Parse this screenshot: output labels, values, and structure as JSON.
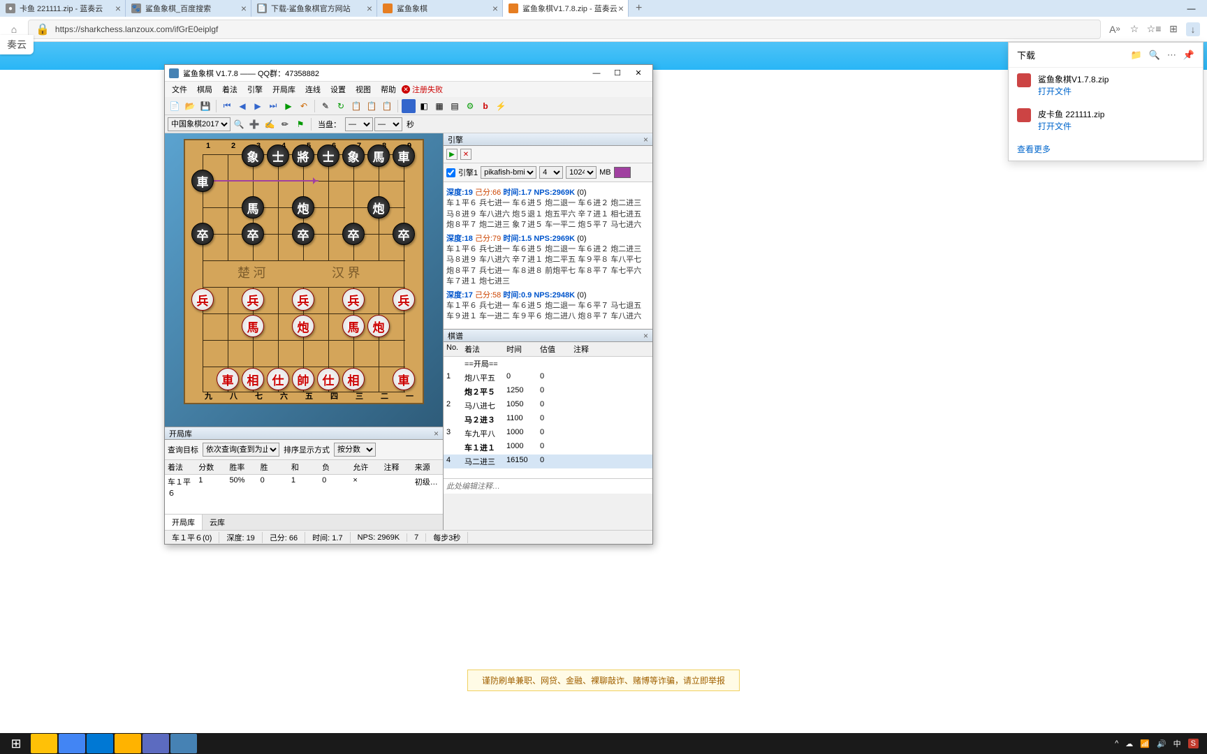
{
  "tabs": [
    {
      "title": "卡鱼 221111.zip - 蓝奏云",
      "active": false
    },
    {
      "title": "鲨鱼象棋_百度搜索",
      "active": false
    },
    {
      "title": "下载-鲨鱼象棋官方网站",
      "active": false
    },
    {
      "title": "鲨鱼象棋",
      "active": false
    },
    {
      "title": "鲨鱼象棋V1.7.8.zip - 蓝奏云",
      "active": true
    }
  ],
  "url": "https://sharkchess.lanzoux.com/ifGrE0eiplgf",
  "page_logo": "奏云",
  "warning": "谨防刷单兼职、网贷、金融、裸聊敲诈、赌博等诈骗，请立即举报",
  "downloads": {
    "title": "下载",
    "items": [
      {
        "name": "鲨鱼象棋V1.7.8.zip",
        "action": "打开文件"
      },
      {
        "name": "皮卡鱼 221111.zip",
        "action": "打开文件"
      }
    ],
    "more": "查看更多"
  },
  "app": {
    "title": "鲨鱼象棋 V1.7.8  —— QQ群：47358882",
    "menus": [
      "文件",
      "棋局",
      "着法",
      "引擎",
      "开局库",
      "连线",
      "设置",
      "视图",
      "帮助"
    ],
    "menu_error": "注册失败",
    "board_set": "中国象棋2017",
    "tb_label_dangqian": "当盘：",
    "tb_label_miao": "秒",
    "col_top": [
      "1",
      "2",
      "3",
      "4",
      "5",
      "6",
      "7",
      "8",
      "9"
    ],
    "col_bot": [
      "九",
      "八",
      "七",
      "六",
      "五",
      "四",
      "三",
      "二",
      "一"
    ],
    "river_l": "楚 河",
    "river_r": "汉 界",
    "engine_panel": "引擎",
    "engine_label": "引擎1",
    "engine_name": "pikafish-bmi2",
    "engine_threads": "4",
    "engine_hash": "1024",
    "engine_mb": "MB",
    "analysis": [
      {
        "depth": "深度:19",
        "score": "己分:66",
        "time": "时间:1.7",
        "nps": "NPS:2969K",
        "nodes": "(0)",
        "line": "车１平６ 兵七进一 车６进５ 炮二退一 车６进２ 炮二进三 马８进９ 车八进六 炮５退１ 炮五平六 辛７进１ 相七进五 炮８平７ 炮二进三 象７进５ 车一平二 炮５平７ 马七进六"
      },
      {
        "depth": "深度:18",
        "score": "己分:79",
        "time": "时间:1.5",
        "nps": "NPS:2969K",
        "nodes": "(0)",
        "line": "车１平６ 兵七进一 车６进５ 炮二退一 车６进２ 炮二进三 马８进９ 车八进六 辛７进１ 炮二平五 车９平８ 车八平七 炮８平７ 兵七进一 车８进８ 前炮平七 车８平７ 车七平六 车７进１ 炮七进三"
      },
      {
        "depth": "深度:17",
        "score": "己分:58",
        "time": "时间:0.9",
        "nps": "NPS:2948K",
        "nodes": "(0)",
        "line": "车１平６ 兵七进一 车６进５ 炮二退一 车６平７ 马七退五 车９进１ 车一进二 车９平６ 炮二进八 炮８平７ 车八进六"
      }
    ],
    "moves_panel": "棋谱",
    "moves_header": {
      "no": "No.",
      "mv": "着法",
      "tm": "时间",
      "ev": "估值",
      "nt": "注释"
    },
    "moves_opening": "==开局==",
    "moves": [
      {
        "no": "1",
        "a": "炮八平五",
        "at": "0",
        "ae": "0",
        "b": "炮２平５",
        "bt": "1250",
        "be": "0"
      },
      {
        "no": "2",
        "a": "马八进七",
        "at": "1050",
        "ae": "0",
        "b": "马２进３",
        "bt": "1100",
        "be": "0"
      },
      {
        "no": "3",
        "a": "车九平八",
        "at": "1000",
        "ae": "0",
        "b": "车１进１",
        "bt": "1000",
        "be": "0"
      },
      {
        "no": "4",
        "a": "马二进三",
        "at": "16150",
        "ae": "0",
        "b": "",
        "bt": "",
        "be": ""
      }
    ],
    "note_placeholder": "此处编辑注释…",
    "openbook_panel": "开局库",
    "ob_q_label": "查询目标",
    "ob_q_combo": "依次查询(查到为止)",
    "ob_s_label": "排序显示方式",
    "ob_s_combo": "按分数",
    "ob_head": [
      "着法",
      "分数",
      "胜率",
      "胜",
      "和",
      "负",
      "允许",
      "注释",
      "来源"
    ],
    "ob_row": [
      "车１平６",
      "1",
      "50%",
      "0",
      "1",
      "0",
      "×",
      "",
      "初级…"
    ],
    "ob_tabs": [
      "开局库",
      "云库"
    ],
    "status": {
      "move": "车１平６(0)",
      "depth": "深度: 19",
      "score": "己分: 66",
      "time": "时间: 1.7",
      "nps": "NPS: 2969K",
      "cnt": "7",
      "step": "每步3秒"
    }
  },
  "tray": {
    "ime": "中"
  }
}
